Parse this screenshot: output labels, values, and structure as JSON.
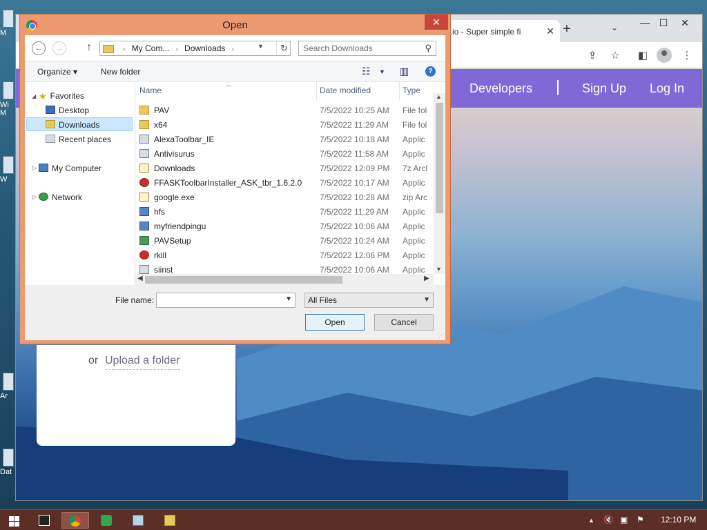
{
  "desktop": {
    "icons": [
      "M",
      "Wi\nM",
      "W",
      "Ar",
      "Dat"
    ]
  },
  "browser": {
    "tab_title": "e.io - Super simple fi",
    "tab_close": "✕",
    "new_tab": "+",
    "tab_dropdown": "⌄",
    "minimize": "—",
    "maximize": "☐",
    "close": "✕",
    "nav": {
      "developers": "Developers",
      "signup": "Sign Up",
      "login": "Log In"
    },
    "upload": {
      "or": "or",
      "folder_link": "Upload a folder"
    }
  },
  "dialog": {
    "title": "Open",
    "close": "✕",
    "address": {
      "crumbs": [
        "My Com...",
        "Downloads"
      ],
      "chevron": "›"
    },
    "search_placeholder": "Search Downloads",
    "commands": {
      "organize": "Organize ▾",
      "new_folder": "New folder"
    },
    "nav_pane": {
      "favorites": "Favorites",
      "desktop": "Desktop",
      "downloads": "Downloads",
      "recent": "Recent places",
      "computer": "My Computer",
      "network": "Network"
    },
    "columns": {
      "name": "Name",
      "date": "Date modified",
      "type": "Type"
    },
    "files": [
      {
        "name": "PAV",
        "date": "7/5/2022 10:25 AM",
        "type": "File fol",
        "icon": "folder"
      },
      {
        "name": "x64",
        "date": "7/5/2022 11:29 AM",
        "type": "File fol",
        "icon": "folder"
      },
      {
        "name": "AlexaToolbar_IE",
        "date": "7/5/2022 10:18 AM",
        "type": "Applic",
        "icon": "app"
      },
      {
        "name": "Antivisurus",
        "date": "7/5/2022 11:58 AM",
        "type": "Applic",
        "icon": "app"
      },
      {
        "name": "Downloads",
        "date": "7/5/2022 12:09 PM",
        "type": "7z Arcl",
        "icon": "zip"
      },
      {
        "name": "FFASKToolbarInstaller_ASK_tbr_1.6.2.0",
        "date": "7/5/2022 10:17 AM",
        "type": "Applic",
        "icon": "app-red"
      },
      {
        "name": "google.exe",
        "date": "7/5/2022 10:28 AM",
        "type": "zip Arc",
        "icon": "zip"
      },
      {
        "name": "hfs",
        "date": "7/5/2022 11:29 AM",
        "type": "Applic",
        "icon": "app-blue"
      },
      {
        "name": "myfriendpingu",
        "date": "7/5/2022 10:06 AM",
        "type": "Applic",
        "icon": "app-blue"
      },
      {
        "name": "PAVSetup",
        "date": "7/5/2022 10:24 AM",
        "type": "Applic",
        "icon": "app-green"
      },
      {
        "name": "rkill",
        "date": "7/5/2022 12:06 PM",
        "type": "Applic",
        "icon": "app-red"
      },
      {
        "name": "siinst",
        "date": "7/5/2022 10:06 AM",
        "type": "Applic",
        "icon": "app"
      }
    ],
    "file_name_label": "File name:",
    "file_name_value": "",
    "filter": "All Files",
    "open_button": "Open",
    "cancel_button": "Cancel"
  },
  "taskbar": {
    "time": "12:10 PM"
  }
}
